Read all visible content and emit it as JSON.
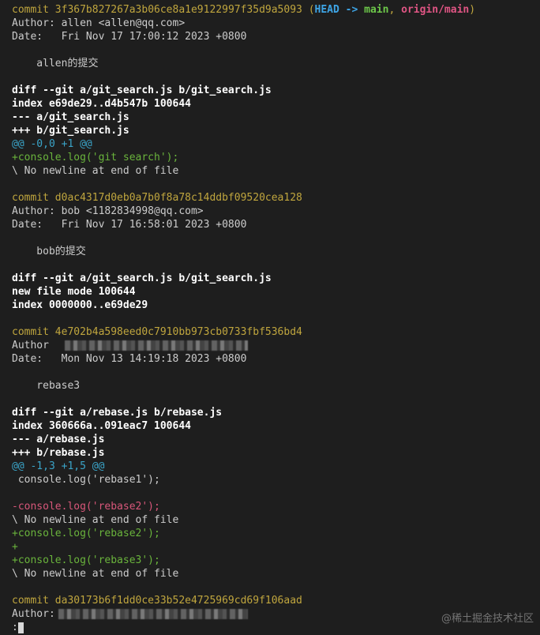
{
  "log": {
    "c1": {
      "commit_label": "commit",
      "hash": "3f367b827267a3b06ce8a1e9122997f35d9a5093",
      "ref_open": "(",
      "ref_head": "HEAD",
      "ref_arrow": "->",
      "ref_branch": "main",
      "ref_sep": ",",
      "ref_origin": "origin/main",
      "ref_close": ")",
      "author": "Author: allen <allen@qq.com>",
      "date": "Date:   Fri Nov 17 17:00:12 2023 +0800",
      "message": "    allen的提交",
      "diff_header": "diff --git a/git_search.js b/git_search.js",
      "index": "index e69de29..d4b547b 100644",
      "minus_file": "--- a/git_search.js",
      "plus_file": "+++ b/git_search.js",
      "hunk": "@@ -0,0 +1 @@",
      "add1": "+console.log('git search');",
      "nonl": "\\ No newline at end of file"
    },
    "c2": {
      "commit_line": "commit d0ac4317d0eb0a7b0f8a78c14ddbf09520cea128",
      "author": "Author: bob <1182834998@qq.com>",
      "date": "Date:   Fri Nov 17 16:58:01 2023 +0800",
      "message": "    bob的提交",
      "diff_header": "diff --git a/git_search.js b/git_search.js",
      "new_mode": "new file mode 100644",
      "index": "index 0000000..e69de29"
    },
    "c3": {
      "commit_line": "commit 4e702b4a598eed0c7910bb973cb0733fbf536bd4",
      "author_label": "Author",
      "date": "Date:   Mon Nov 13 14:19:18 2023 +0800",
      "message": "    rebase3",
      "diff_header": "diff --git a/rebase.js b/rebase.js",
      "index": "index 360666a..091eac7 100644",
      "minus_file": "--- a/rebase.js",
      "plus_file": "+++ b/rebase.js",
      "hunk": "@@ -1,3 +1,5 @@",
      "ctx1": " console.log('rebase1');",
      "del1": "-console.log('rebase2');",
      "nonl1": "\\ No newline at end of file",
      "add1": "+console.log('rebase2');",
      "add2": "+",
      "add3": "+console.log('rebase3');",
      "nonl2": "\\ No newline at end of file"
    },
    "c4": {
      "commit_line": "commit da30173b6f1dd0ce33b52e4725969cd69f106aad",
      "author_label": "Author:"
    }
  },
  "pager": {
    "prompt": ":"
  },
  "watermark": "@稀土掘金技术社区"
}
